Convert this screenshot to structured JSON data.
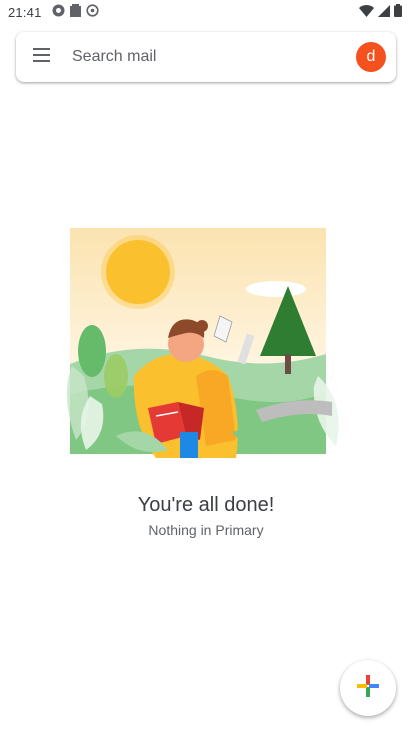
{
  "status_bar": {
    "time": "21:41",
    "left_icons": [
      "app-notification-icon",
      "storage-icon",
      "sync-icon"
    ],
    "right_icons": [
      "wifi-icon",
      "cell-signal-icon",
      "battery-icon"
    ]
  },
  "search": {
    "placeholder": "Search mail",
    "menu_icon": "hamburger-menu-icon"
  },
  "account": {
    "initial": "d",
    "color": "#f4511e"
  },
  "empty_state": {
    "title": "You're all done!",
    "subtitle": "Nothing in Primary",
    "illustration": "person-reading-in-field-illustration"
  },
  "compose": {
    "icon": "compose-plus-icon",
    "colors": [
      "#4285f4",
      "#ea4335",
      "#fbbc04",
      "#34a853"
    ]
  }
}
